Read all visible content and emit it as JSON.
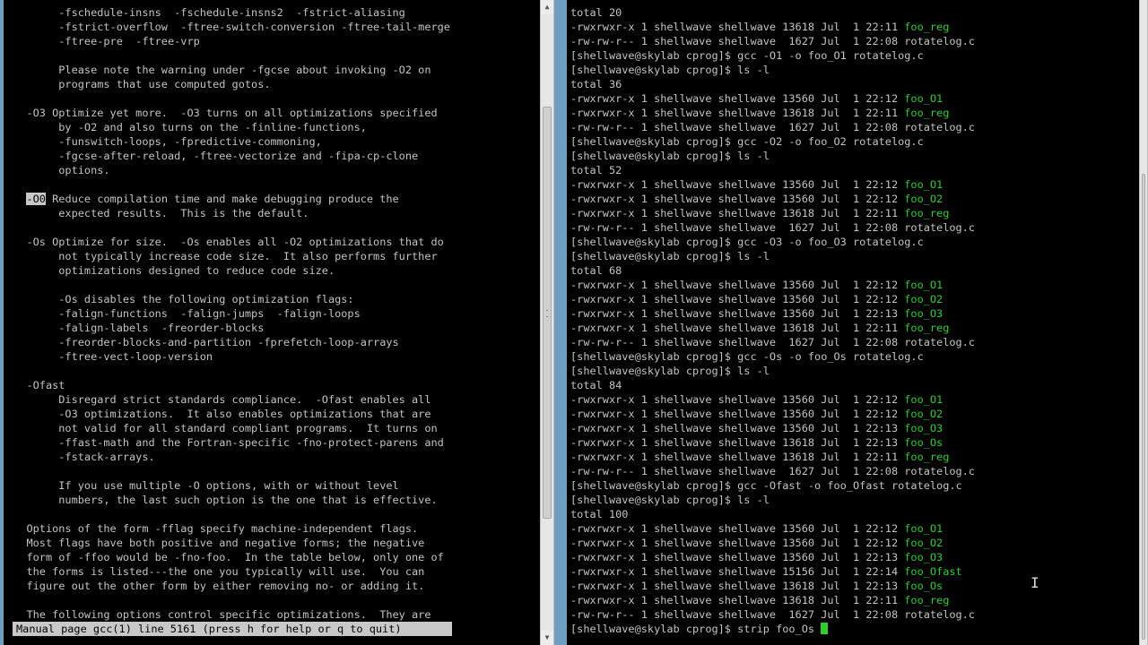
{
  "left_terminal": {
    "lines": [
      [
        {
          "t": "        -fschedule-insns  -fschedule-insns2  -fstrict-aliasing"
        }
      ],
      [
        {
          "t": "        -fstrict-overflow  -ftree-switch-conversion -ftree-tail-merge"
        }
      ],
      [
        {
          "t": "        -ftree-pre  -ftree-vrp"
        }
      ],
      [
        {
          "t": ""
        }
      ],
      [
        {
          "t": "        Please note the warning under -fgcse about invoking -O2 on"
        }
      ],
      [
        {
          "t": "        programs that use computed gotos."
        }
      ],
      [
        {
          "t": ""
        }
      ],
      [
        {
          "t": "   -O3 Optimize yet more.  -O3 turns on all optimizations specified"
        }
      ],
      [
        {
          "t": "        by -O2 and also turns on the -finline-functions,"
        }
      ],
      [
        {
          "t": "        -funswitch-loops, -fpredictive-commoning,"
        }
      ],
      [
        {
          "t": "        -fgcse-after-reload, -ftree-vectorize and -fipa-cp-clone"
        }
      ],
      [
        {
          "t": "        options."
        }
      ],
      [
        {
          "t": ""
        }
      ],
      [
        {
          "t": "   "
        },
        {
          "t": "-O0",
          "c": "hl"
        },
        {
          "t": " Reduce compilation time and make debugging produce the"
        }
      ],
      [
        {
          "t": "        expected results.  This is the default."
        }
      ],
      [
        {
          "t": ""
        }
      ],
      [
        {
          "t": "   -Os Optimize for size.  -Os enables all -O2 optimizations that do"
        }
      ],
      [
        {
          "t": "        not typically increase code size.  It also performs further"
        }
      ],
      [
        {
          "t": "        optimizations designed to reduce code size."
        }
      ],
      [
        {
          "t": ""
        }
      ],
      [
        {
          "t": "        -Os disables the following optimization flags:"
        }
      ],
      [
        {
          "t": "        -falign-functions  -falign-jumps  -falign-loops"
        }
      ],
      [
        {
          "t": "        -falign-labels  -freorder-blocks"
        }
      ],
      [
        {
          "t": "        -freorder-blocks-and-partition -fprefetch-loop-arrays"
        }
      ],
      [
        {
          "t": "        -ftree-vect-loop-version"
        }
      ],
      [
        {
          "t": ""
        }
      ],
      [
        {
          "t": "   -Ofast"
        }
      ],
      [
        {
          "t": "        Disregard strict standards compliance.  -Ofast enables all"
        }
      ],
      [
        {
          "t": "        -O3 optimizations.  It also enables optimizations that are"
        }
      ],
      [
        {
          "t": "        not valid for all standard compliant programs.  It turns on"
        }
      ],
      [
        {
          "t": "        -ffast-math and the Fortran-specific -fno-protect-parens and"
        }
      ],
      [
        {
          "t": "        -fstack-arrays."
        }
      ],
      [
        {
          "t": ""
        }
      ],
      [
        {
          "t": "        If you use multiple -O options, with or without level"
        }
      ],
      [
        {
          "t": "        numbers, the last such option is the one that is effective."
        }
      ],
      [
        {
          "t": ""
        }
      ],
      [
        {
          "t": "   Options of the form -fflag specify machine-independent flags."
        }
      ],
      [
        {
          "t": "   Most flags have both positive and negative forms; the negative"
        }
      ],
      [
        {
          "t": "   form of -ffoo would be -fno-foo.  In the table below, only one of"
        }
      ],
      [
        {
          "t": "   the forms is listed---the one you typically will use.  You can"
        }
      ],
      [
        {
          "t": "   figure out the other form by either removing no- or adding it."
        }
      ],
      [
        {
          "t": ""
        }
      ],
      [
        {
          "t": "   The following options control specific optimizations.  They are"
        }
      ]
    ],
    "status": "Manual page gcc(1) line 5161 (press h for help or q to quit)"
  },
  "right_terminal": {
    "lines": [
      [
        {
          "t": "total 20"
        }
      ],
      [
        {
          "t": "-rwxrwxr-x 1 shellwave shellwave 13618 Jul  1 22:11 "
        },
        {
          "t": "foo_reg",
          "c": "green"
        }
      ],
      [
        {
          "t": "-rw-rw-r-- 1 shellwave shellwave  1627 Jul  1 22:08 rotatelog.c"
        }
      ],
      [
        {
          "t": "[shellwave@skylab cprog]$ gcc -O1 -o foo_O1 rotatelog.c"
        }
      ],
      [
        {
          "t": "[shellwave@skylab cprog]$ ls -l"
        }
      ],
      [
        {
          "t": "total 36"
        }
      ],
      [
        {
          "t": "-rwxrwxr-x 1 shellwave shellwave 13560 Jul  1 22:12 "
        },
        {
          "t": "foo_O1",
          "c": "green"
        }
      ],
      [
        {
          "t": "-rwxrwxr-x 1 shellwave shellwave 13618 Jul  1 22:11 "
        },
        {
          "t": "foo_reg",
          "c": "green"
        }
      ],
      [
        {
          "t": "-rw-rw-r-- 1 shellwave shellwave  1627 Jul  1 22:08 rotatelog.c"
        }
      ],
      [
        {
          "t": "[shellwave@skylab cprog]$ gcc -O2 -o foo_O2 rotatelog.c"
        }
      ],
      [
        {
          "t": "[shellwave@skylab cprog]$ ls -l"
        }
      ],
      [
        {
          "t": "total 52"
        }
      ],
      [
        {
          "t": "-rwxrwxr-x 1 shellwave shellwave 13560 Jul  1 22:12 "
        },
        {
          "t": "foo_O1",
          "c": "green"
        }
      ],
      [
        {
          "t": "-rwxrwxr-x 1 shellwave shellwave 13560 Jul  1 22:12 "
        },
        {
          "t": "foo_O2",
          "c": "green"
        }
      ],
      [
        {
          "t": "-rwxrwxr-x 1 shellwave shellwave 13618 Jul  1 22:11 "
        },
        {
          "t": "foo_reg",
          "c": "green"
        }
      ],
      [
        {
          "t": "-rw-rw-r-- 1 shellwave shellwave  1627 Jul  1 22:08 rotatelog.c"
        }
      ],
      [
        {
          "t": "[shellwave@skylab cprog]$ gcc -O3 -o foo_O3 rotatelog.c"
        }
      ],
      [
        {
          "t": "[shellwave@skylab cprog]$ ls -l"
        }
      ],
      [
        {
          "t": "total 68"
        }
      ],
      [
        {
          "t": "-rwxrwxr-x 1 shellwave shellwave 13560 Jul  1 22:12 "
        },
        {
          "t": "foo_O1",
          "c": "green"
        }
      ],
      [
        {
          "t": "-rwxrwxr-x 1 shellwave shellwave 13560 Jul  1 22:12 "
        },
        {
          "t": "foo_O2",
          "c": "green"
        }
      ],
      [
        {
          "t": "-rwxrwxr-x 1 shellwave shellwave 13560 Jul  1 22:13 "
        },
        {
          "t": "foo_O3",
          "c": "green"
        }
      ],
      [
        {
          "t": "-rwxrwxr-x 1 shellwave shellwave 13618 Jul  1 22:11 "
        },
        {
          "t": "foo_reg",
          "c": "green"
        }
      ],
      [
        {
          "t": "-rw-rw-r-- 1 shellwave shellwave  1627 Jul  1 22:08 rotatelog.c"
        }
      ],
      [
        {
          "t": "[shellwave@skylab cprog]$ gcc -Os -o foo_Os rotatelog.c"
        }
      ],
      [
        {
          "t": "[shellwave@skylab cprog]$ ls -l"
        }
      ],
      [
        {
          "t": "total 84"
        }
      ],
      [
        {
          "t": "-rwxrwxr-x 1 shellwave shellwave 13560 Jul  1 22:12 "
        },
        {
          "t": "foo_O1",
          "c": "green"
        }
      ],
      [
        {
          "t": "-rwxrwxr-x 1 shellwave shellwave 13560 Jul  1 22:12 "
        },
        {
          "t": "foo_O2",
          "c": "green"
        }
      ],
      [
        {
          "t": "-rwxrwxr-x 1 shellwave shellwave 13560 Jul  1 22:13 "
        },
        {
          "t": "foo_O3",
          "c": "green"
        }
      ],
      [
        {
          "t": "-rwxrwxr-x 1 shellwave shellwave 13618 Jul  1 22:13 "
        },
        {
          "t": "foo_Os",
          "c": "green"
        }
      ],
      [
        {
          "t": "-rwxrwxr-x 1 shellwave shellwave 13618 Jul  1 22:11 "
        },
        {
          "t": "foo_reg",
          "c": "green"
        }
      ],
      [
        {
          "t": "-rw-rw-r-- 1 shellwave shellwave  1627 Jul  1 22:08 rotatelog.c"
        }
      ],
      [
        {
          "t": "[shellwave@skylab cprog]$ gcc -Ofast -o foo_Ofast rotatelog.c"
        }
      ],
      [
        {
          "t": "[shellwave@skylab cprog]$ ls -l"
        }
      ],
      [
        {
          "t": "total 100"
        }
      ],
      [
        {
          "t": "-rwxrwxr-x 1 shellwave shellwave 13560 Jul  1 22:12 "
        },
        {
          "t": "foo_O1",
          "c": "green"
        }
      ],
      [
        {
          "t": "-rwxrwxr-x 1 shellwave shellwave 13560 Jul  1 22:12 "
        },
        {
          "t": "foo_O2",
          "c": "green"
        }
      ],
      [
        {
          "t": "-rwxrwxr-x 1 shellwave shellwave 13560 Jul  1 22:13 "
        },
        {
          "t": "foo_O3",
          "c": "green"
        }
      ],
      [
        {
          "t": "-rwxrwxr-x 1 shellwave shellwave 15156 Jul  1 22:14 "
        },
        {
          "t": "foo_Ofast",
          "c": "green"
        }
      ],
      [
        {
          "t": "-rwxrwxr-x 1 shellwave shellwave 13618 Jul  1 22:13 "
        },
        {
          "t": "foo_Os",
          "c": "green"
        }
      ],
      [
        {
          "t": "-rwxrwxr-x 1 shellwave shellwave 13618 Jul  1 22:11 "
        },
        {
          "t": "foo_reg",
          "c": "green"
        }
      ],
      [
        {
          "t": "-rw-rw-r-- 1 shellwave shellwave  1627 Jul  1 22:08 rotatelog.c"
        }
      ],
      [
        {
          "t": "[shellwave@skylab cprog]$ strip foo_Os "
        }
      ]
    ]
  },
  "colors": {
    "background": "#6f9fc0",
    "terminal_bg": "#000000",
    "terminal_fg": "#c4c4c4",
    "executable_green": "#2fce2f"
  },
  "icons": {
    "scroll_up": "▲",
    "scroll_down": "▼",
    "mouse_ibeam": "I"
  },
  "scroll": {
    "left_position": 0.45,
    "right_position": 0.98
  }
}
